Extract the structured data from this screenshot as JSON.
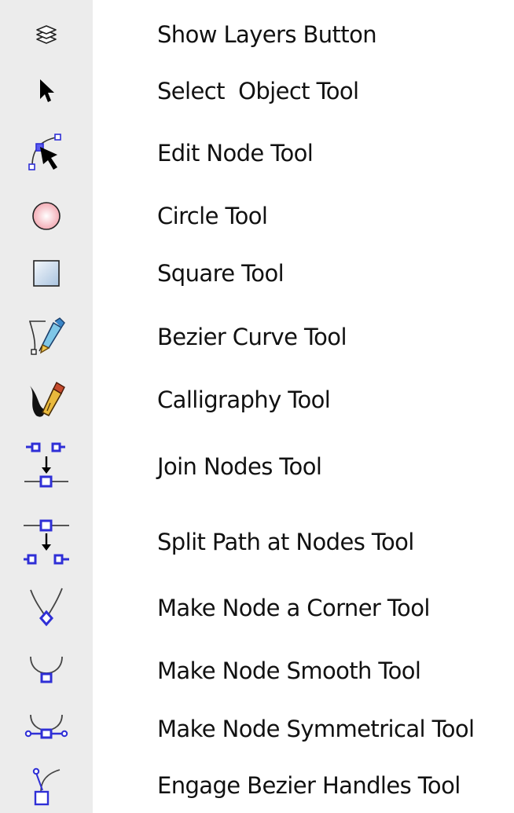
{
  "tools": [
    {
      "icon": "layers-icon",
      "label": "Show Layers Button"
    },
    {
      "icon": "select-arrow-icon",
      "label": "Select  Object Tool"
    },
    {
      "icon": "edit-node-icon",
      "label": "Edit Node Tool"
    },
    {
      "icon": "circle-icon",
      "label": "Circle Tool"
    },
    {
      "icon": "square-icon",
      "label": "Square Tool"
    },
    {
      "icon": "bezier-pen-icon",
      "label": "Bezier Curve Tool"
    },
    {
      "icon": "calligraphy-pen-icon",
      "label": "Calligraphy Tool"
    },
    {
      "icon": "join-nodes-icon",
      "label": "Join Nodes Tool"
    },
    {
      "icon": "split-path-icon",
      "label": "Split Path at Nodes Tool"
    },
    {
      "icon": "corner-node-icon",
      "label": "Make Node a Corner Tool"
    },
    {
      "icon": "smooth-node-icon",
      "label": "Make Node Smooth Tool"
    },
    {
      "icon": "symmetric-node-icon",
      "label": "Make Node Symmetrical Tool"
    },
    {
      "icon": "bezier-handles-icon",
      "label": "Engage Bezier Handles Tool"
    }
  ],
  "colors": {
    "strip": "#ececec",
    "node_blue": "#2f2fd6",
    "text": "#111111"
  }
}
